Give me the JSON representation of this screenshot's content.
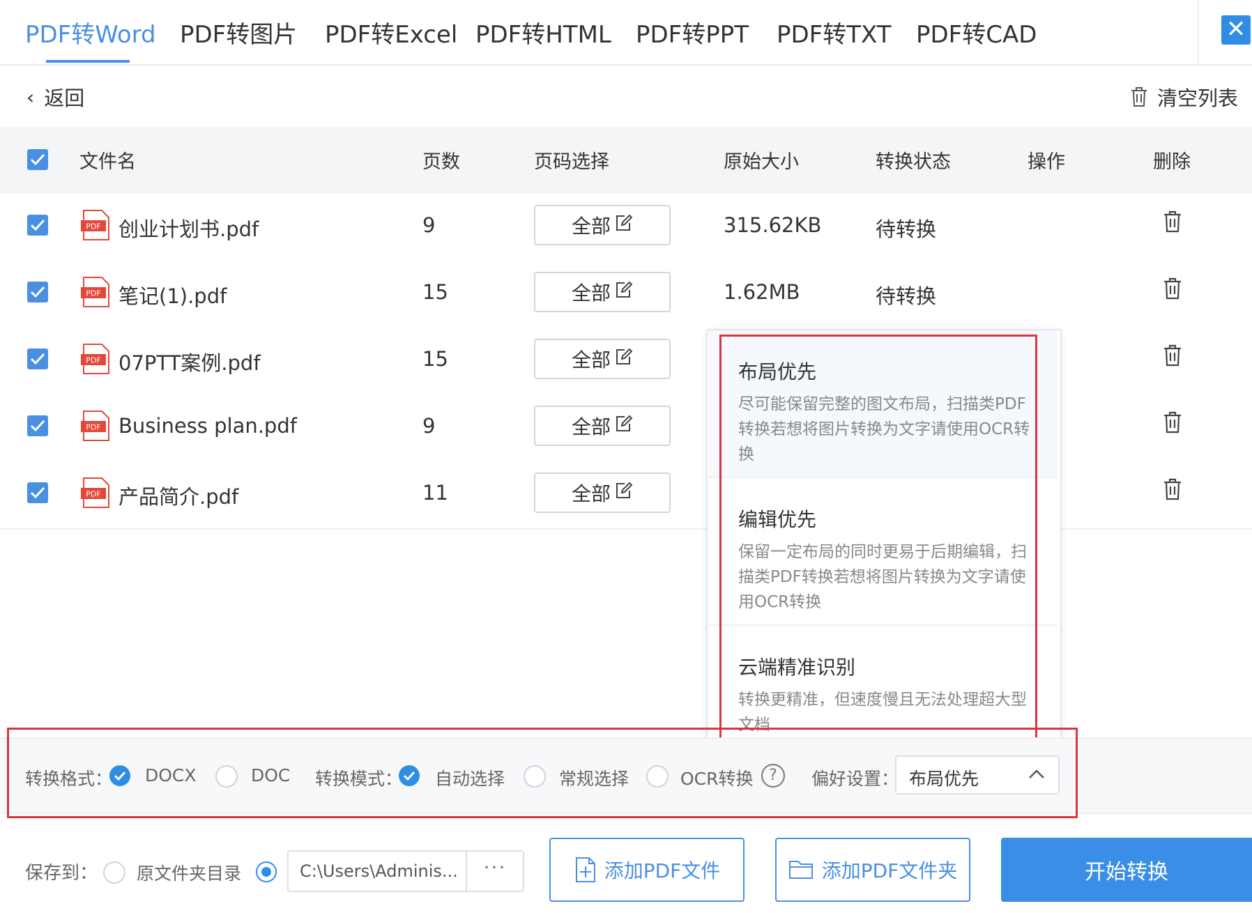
{
  "tabs": [
    {
      "label": "PDF转Word",
      "active": true
    },
    {
      "label": "PDF转图片",
      "active": false
    },
    {
      "label": "PDF转Excel",
      "active": false
    },
    {
      "label": "PDF转HTML",
      "active": false
    },
    {
      "label": "PDF转PPT",
      "active": false
    },
    {
      "label": "PDF转TXT",
      "active": false
    },
    {
      "label": "PDF转CAD",
      "active": false
    }
  ],
  "header": {
    "close_label": "✕"
  },
  "nav": {
    "back_label": "返回",
    "clear_label": "清空列表"
  },
  "table": {
    "columns": [
      "文件名",
      "页数",
      "页码选择",
      "原始大小",
      "转换状态",
      "操作",
      "删除"
    ],
    "rows": [
      {
        "name": "创业计划书.pdf",
        "pages": "9",
        "range": "全部",
        "size": "315.62KB",
        "status": "待转换"
      },
      {
        "name": "笔记(1).pdf",
        "pages": "15",
        "range": "全部",
        "size": "1.62MB",
        "status": "待转换"
      },
      {
        "name": "07PTT案例.pdf",
        "pages": "15",
        "range": "全部",
        "size": "",
        "status": ""
      },
      {
        "name": "Business plan.pdf",
        "pages": "9",
        "range": "全部",
        "size": "",
        "status": ""
      },
      {
        "name": "产品简介.pdf",
        "pages": "11",
        "range": "全部",
        "size": "",
        "status": ""
      }
    ]
  },
  "dropdown": {
    "options": [
      {
        "title": "布局优先",
        "desc": "尽可能保留完整的图文布局，扫描类PDF转换若想将图片转换为文字请使用OCR转换",
        "selected": true
      },
      {
        "title": "编辑优先",
        "desc": "保留一定布局的同时更易于后期编辑，扫描类PDF转换若想将图片转换为文字请使用OCR转换",
        "selected": false
      },
      {
        "title": "云端精准识别",
        "desc": "转换更精准，但速度慢且无法处理超大型文档",
        "selected": false
      }
    ]
  },
  "options_bar": {
    "format_label": "转换格式：",
    "format_docx": "DOCX",
    "format_doc": "DOC",
    "mode_label": "转换模式：",
    "mode_auto": "自动选择",
    "mode_normal": "常规选择",
    "mode_ocr": "OCR转换",
    "help": "?",
    "pref_label": "偏好设置：",
    "pref_value": "布局优先"
  },
  "bottom": {
    "save_label": "保存到：",
    "orig_folder": "原文件夹目录",
    "path": "C:\\Users\\Adminis...",
    "more": "···",
    "add_file": "添加PDF文件",
    "add_folder": "添加PDF文件夹",
    "start": "开始转换"
  },
  "colors": {
    "accent": "#4a90e2",
    "highlight_box": "#d9363e",
    "pdf_icon": "#e2473b"
  }
}
